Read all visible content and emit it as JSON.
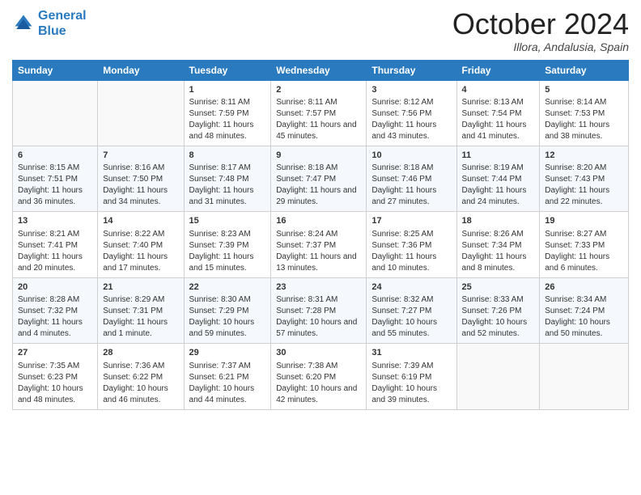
{
  "logo": {
    "line1": "General",
    "line2": "Blue"
  },
  "title": "October 2024",
  "location": "Illora, Andalusia, Spain",
  "days_of_week": [
    "Sunday",
    "Monday",
    "Tuesday",
    "Wednesday",
    "Thursday",
    "Friday",
    "Saturday"
  ],
  "weeks": [
    [
      {
        "day": "",
        "sunrise": "",
        "sunset": "",
        "daylight": ""
      },
      {
        "day": "",
        "sunrise": "",
        "sunset": "",
        "daylight": ""
      },
      {
        "day": "1",
        "sunrise": "Sunrise: 8:11 AM",
        "sunset": "Sunset: 7:59 PM",
        "daylight": "Daylight: 11 hours and 48 minutes."
      },
      {
        "day": "2",
        "sunrise": "Sunrise: 8:11 AM",
        "sunset": "Sunset: 7:57 PM",
        "daylight": "Daylight: 11 hours and 45 minutes."
      },
      {
        "day": "3",
        "sunrise": "Sunrise: 8:12 AM",
        "sunset": "Sunset: 7:56 PM",
        "daylight": "Daylight: 11 hours and 43 minutes."
      },
      {
        "day": "4",
        "sunrise": "Sunrise: 8:13 AM",
        "sunset": "Sunset: 7:54 PM",
        "daylight": "Daylight: 11 hours and 41 minutes."
      },
      {
        "day": "5",
        "sunrise": "Sunrise: 8:14 AM",
        "sunset": "Sunset: 7:53 PM",
        "daylight": "Daylight: 11 hours and 38 minutes."
      }
    ],
    [
      {
        "day": "6",
        "sunrise": "Sunrise: 8:15 AM",
        "sunset": "Sunset: 7:51 PM",
        "daylight": "Daylight: 11 hours and 36 minutes."
      },
      {
        "day": "7",
        "sunrise": "Sunrise: 8:16 AM",
        "sunset": "Sunset: 7:50 PM",
        "daylight": "Daylight: 11 hours and 34 minutes."
      },
      {
        "day": "8",
        "sunrise": "Sunrise: 8:17 AM",
        "sunset": "Sunset: 7:48 PM",
        "daylight": "Daylight: 11 hours and 31 minutes."
      },
      {
        "day": "9",
        "sunrise": "Sunrise: 8:18 AM",
        "sunset": "Sunset: 7:47 PM",
        "daylight": "Daylight: 11 hours and 29 minutes."
      },
      {
        "day": "10",
        "sunrise": "Sunrise: 8:18 AM",
        "sunset": "Sunset: 7:46 PM",
        "daylight": "Daylight: 11 hours and 27 minutes."
      },
      {
        "day": "11",
        "sunrise": "Sunrise: 8:19 AM",
        "sunset": "Sunset: 7:44 PM",
        "daylight": "Daylight: 11 hours and 24 minutes."
      },
      {
        "day": "12",
        "sunrise": "Sunrise: 8:20 AM",
        "sunset": "Sunset: 7:43 PM",
        "daylight": "Daylight: 11 hours and 22 minutes."
      }
    ],
    [
      {
        "day": "13",
        "sunrise": "Sunrise: 8:21 AM",
        "sunset": "Sunset: 7:41 PM",
        "daylight": "Daylight: 11 hours and 20 minutes."
      },
      {
        "day": "14",
        "sunrise": "Sunrise: 8:22 AM",
        "sunset": "Sunset: 7:40 PM",
        "daylight": "Daylight: 11 hours and 17 minutes."
      },
      {
        "day": "15",
        "sunrise": "Sunrise: 8:23 AM",
        "sunset": "Sunset: 7:39 PM",
        "daylight": "Daylight: 11 hours and 15 minutes."
      },
      {
        "day": "16",
        "sunrise": "Sunrise: 8:24 AM",
        "sunset": "Sunset: 7:37 PM",
        "daylight": "Daylight: 11 hours and 13 minutes."
      },
      {
        "day": "17",
        "sunrise": "Sunrise: 8:25 AM",
        "sunset": "Sunset: 7:36 PM",
        "daylight": "Daylight: 11 hours and 10 minutes."
      },
      {
        "day": "18",
        "sunrise": "Sunrise: 8:26 AM",
        "sunset": "Sunset: 7:34 PM",
        "daylight": "Daylight: 11 hours and 8 minutes."
      },
      {
        "day": "19",
        "sunrise": "Sunrise: 8:27 AM",
        "sunset": "Sunset: 7:33 PM",
        "daylight": "Daylight: 11 hours and 6 minutes."
      }
    ],
    [
      {
        "day": "20",
        "sunrise": "Sunrise: 8:28 AM",
        "sunset": "Sunset: 7:32 PM",
        "daylight": "Daylight: 11 hours and 4 minutes."
      },
      {
        "day": "21",
        "sunrise": "Sunrise: 8:29 AM",
        "sunset": "Sunset: 7:31 PM",
        "daylight": "Daylight: 11 hours and 1 minute."
      },
      {
        "day": "22",
        "sunrise": "Sunrise: 8:30 AM",
        "sunset": "Sunset: 7:29 PM",
        "daylight": "Daylight: 10 hours and 59 minutes."
      },
      {
        "day": "23",
        "sunrise": "Sunrise: 8:31 AM",
        "sunset": "Sunset: 7:28 PM",
        "daylight": "Daylight: 10 hours and 57 minutes."
      },
      {
        "day": "24",
        "sunrise": "Sunrise: 8:32 AM",
        "sunset": "Sunset: 7:27 PM",
        "daylight": "Daylight: 10 hours and 55 minutes."
      },
      {
        "day": "25",
        "sunrise": "Sunrise: 8:33 AM",
        "sunset": "Sunset: 7:26 PM",
        "daylight": "Daylight: 10 hours and 52 minutes."
      },
      {
        "day": "26",
        "sunrise": "Sunrise: 8:34 AM",
        "sunset": "Sunset: 7:24 PM",
        "daylight": "Daylight: 10 hours and 50 minutes."
      }
    ],
    [
      {
        "day": "27",
        "sunrise": "Sunrise: 7:35 AM",
        "sunset": "Sunset: 6:23 PM",
        "daylight": "Daylight: 10 hours and 48 minutes."
      },
      {
        "day": "28",
        "sunrise": "Sunrise: 7:36 AM",
        "sunset": "Sunset: 6:22 PM",
        "daylight": "Daylight: 10 hours and 46 minutes."
      },
      {
        "day": "29",
        "sunrise": "Sunrise: 7:37 AM",
        "sunset": "Sunset: 6:21 PM",
        "daylight": "Daylight: 10 hours and 44 minutes."
      },
      {
        "day": "30",
        "sunrise": "Sunrise: 7:38 AM",
        "sunset": "Sunset: 6:20 PM",
        "daylight": "Daylight: 10 hours and 42 minutes."
      },
      {
        "day": "31",
        "sunrise": "Sunrise: 7:39 AM",
        "sunset": "Sunset: 6:19 PM",
        "daylight": "Daylight: 10 hours and 39 minutes."
      },
      {
        "day": "",
        "sunrise": "",
        "sunset": "",
        "daylight": ""
      },
      {
        "day": "",
        "sunrise": "",
        "sunset": "",
        "daylight": ""
      }
    ]
  ]
}
